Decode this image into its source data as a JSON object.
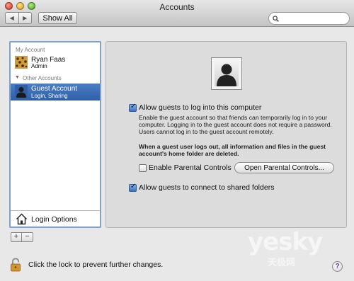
{
  "window": {
    "title": "Accounts"
  },
  "toolbar": {
    "show_all": "Show All",
    "back": "◀",
    "forward": "▶"
  },
  "search": {
    "value": "",
    "placeholder": ""
  },
  "sidebar": {
    "my_account_header": "My Account",
    "my_account": {
      "name": "Ryan Faas",
      "role": "Admin"
    },
    "other_accounts_header": "Other Accounts",
    "selected": {
      "name": "Guest Account",
      "role": "Login, Sharing"
    },
    "login_options": "Login Options"
  },
  "list_controls": {
    "add": "+",
    "remove": "−"
  },
  "guest": {
    "allow_login": {
      "label": "Allow guests to log into this computer",
      "checked": true
    },
    "description": "Enable the guest account so that friends can temporarily log in to your computer. Logging in to the guest account does not require a password. Users cannot log in to the guest account remotely.",
    "warning": "When a guest user logs out, all information and files in the guest account's home folder are deleted.",
    "parental_controls": {
      "label": "Enable Parental Controls",
      "checked": false
    },
    "open_parental_button": "Open Parental Controls...",
    "shared_folders": {
      "label": "Allow guests to connect to shared folders",
      "checked": true
    }
  },
  "footer": {
    "lock_text": "Click the lock to prevent further changes.",
    "help": "?"
  },
  "watermark": {
    "main": "yesky",
    "sub": "天极网"
  },
  "colors": {
    "selection": "#3a6db5",
    "sidebar_border": "#7da2ce",
    "panel": "#dcdcdc"
  }
}
